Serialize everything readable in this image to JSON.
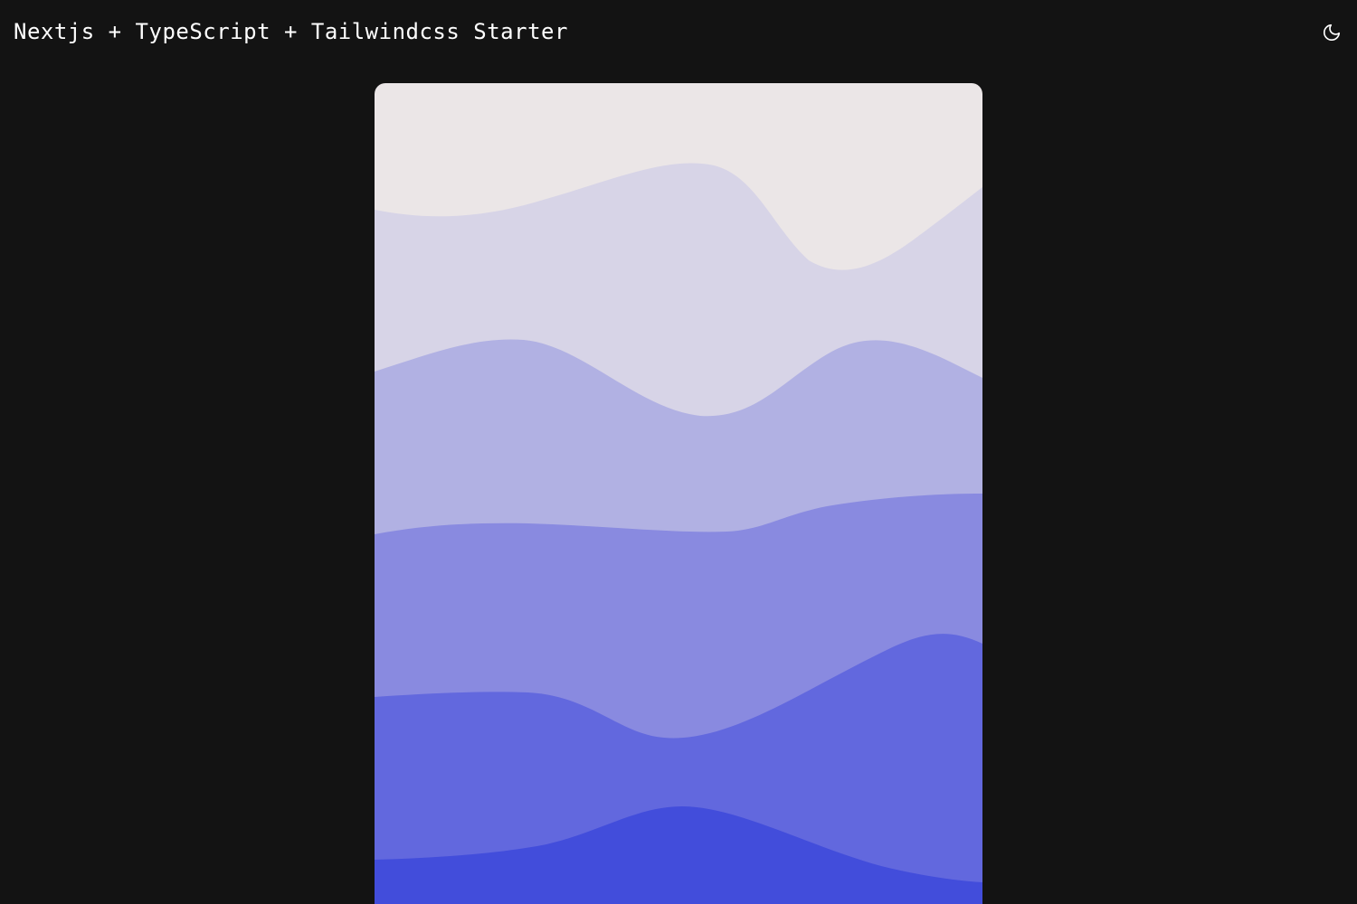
{
  "header": {
    "title": "Nextjs + TypeScript + Tailwindcss Starter",
    "theme_toggle_icon": "moon-icon"
  },
  "colors": {
    "page_background": "#131313",
    "title_text": "#ffffff",
    "icon_stroke": "#ffffff",
    "wave_layers": [
      "#ebe6e7",
      "#d7d4e7",
      "#b1b1e3",
      "#898ae0",
      "#6268de",
      "#424ddb"
    ]
  }
}
